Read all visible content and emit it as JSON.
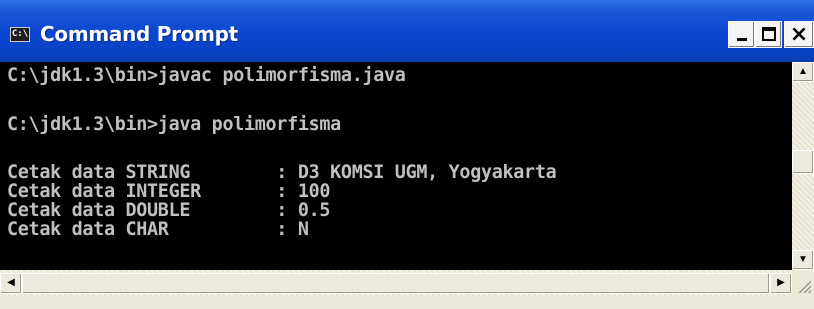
{
  "window": {
    "title": "Command Prompt",
    "icon": "cmd-icon",
    "icon_text": "C:\\",
    "controls": {
      "minimize": "minimize-icon",
      "maximize": "maximize-icon",
      "close_glyph": "×"
    }
  },
  "console": {
    "lines": [
      "C:\\jdk1.3\\bin>javac polimorfisma.java",
      "",
      "C:\\jdk1.3\\bin>java polimorfisma",
      "",
      "Cetak data STRING        : D3 KOMSI UGM, Yogyakarta",
      "Cetak data INTEGER       : 100",
      "Cetak data DOUBLE        : 0.5",
      "Cetak data CHAR          : N"
    ],
    "colors": {
      "background": "#000000",
      "text": "#c0c0c0"
    }
  },
  "scrollbars": {
    "up_glyph": "▲",
    "down_glyph": "▼",
    "left_glyph": "◀",
    "right_glyph": "▶"
  },
  "colors": {
    "titlebar": "#0a46d1",
    "chrome": "#ece9d8"
  }
}
